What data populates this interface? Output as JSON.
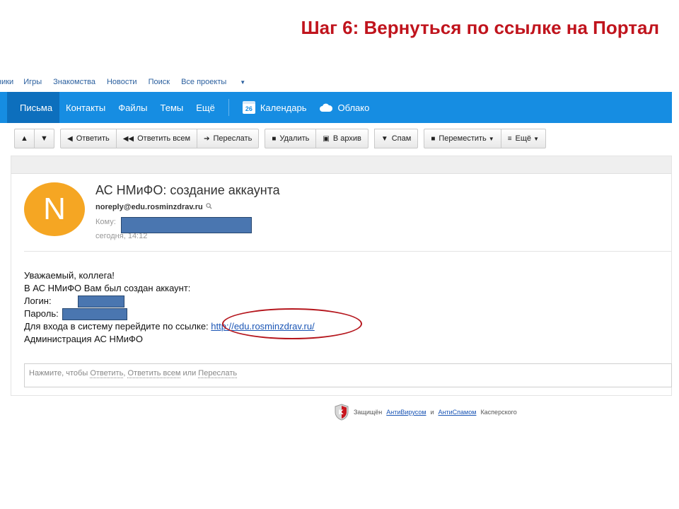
{
  "slide_title": "Шаг 6: Вернуться по ссылке на Портал",
  "top_links": [
    {
      "label": "ники"
    },
    {
      "label": "Игры"
    },
    {
      "label": "Знакомства"
    },
    {
      "label": "Новости"
    },
    {
      "label": "Поиск"
    },
    {
      "label": "Все проекты"
    }
  ],
  "nav": {
    "items": [
      "Письма",
      "Контакты",
      "Файлы",
      "Темы",
      "Ещё"
    ],
    "calendar_day": "26",
    "calendar": "Календарь",
    "cloud": "Облако"
  },
  "toolbar": {
    "reply": "Ответить",
    "reply_all": "Ответить всем",
    "forward": "Переслать",
    "delete": "Удалить",
    "archive": "В архив",
    "spam": "Спам",
    "move": "Переместить",
    "more": "Ещё"
  },
  "message": {
    "avatar_letter": "N",
    "subject": "АС НМиФО: создание аккаунта",
    "sender": "noreply@edu.rosminzdrav.ru",
    "to_label": "Кому:",
    "date": "сегодня, 14:12",
    "greeting": "Уважаемый, коллега!",
    "line2": "В АС НМиФО Вам был создан аккаунт:",
    "login_label": "Логин:",
    "password_label": "Пароль:",
    "link_intro": "Для входа в систему перейдите по ссылке:",
    "link": "http://edu.rosminzdrav.ru/",
    "signature": "Администрация АС НМиФО"
  },
  "reply_box": {
    "prefix": "Нажмите, чтобы",
    "reply": "Ответить",
    "comma": ",",
    "reply_all": "Ответить всем",
    "or": "или",
    "forward": "Переслать"
  },
  "footer": {
    "text_start": "Защищён",
    "antivirus": "АнтиВирусом",
    "and": "и",
    "antispam": "АнтиСпамом",
    "brand": "Касперского"
  },
  "colors": {
    "nav_blue": "#168de2",
    "avatar": "#f5a623",
    "highlight": "#b5161d",
    "title_red": "#c0141d"
  }
}
